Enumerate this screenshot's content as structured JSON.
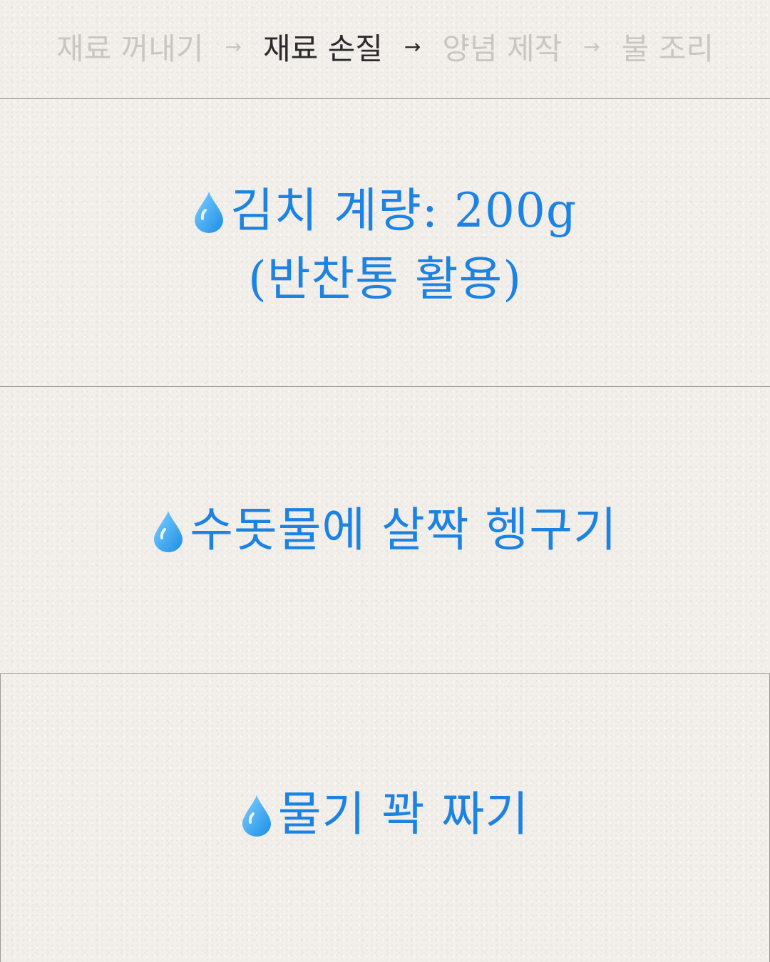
{
  "steps": [
    {
      "label": "재료 꺼내기",
      "active": false
    },
    {
      "label": "재료 손질",
      "active": true
    },
    {
      "label": "양념 제작",
      "active": false
    },
    {
      "label": "불 조리",
      "active": false
    }
  ],
  "arrow": "→",
  "panels": [
    {
      "icon": "water-drop-icon",
      "line1": "김치 계량: 200g",
      "line2": "(반찬통 활용)"
    },
    {
      "icon": "water-drop-icon",
      "line1": "수돗물에 살짝 헹구기"
    },
    {
      "icon": "water-drop-icon",
      "line1": "물기 꽉 짜기"
    }
  ],
  "colors": {
    "text_blue": "#1c82e3",
    "step_active": "#2b2b2b",
    "step_inactive": "#c9c6c2",
    "background": "#f2efeb"
  }
}
